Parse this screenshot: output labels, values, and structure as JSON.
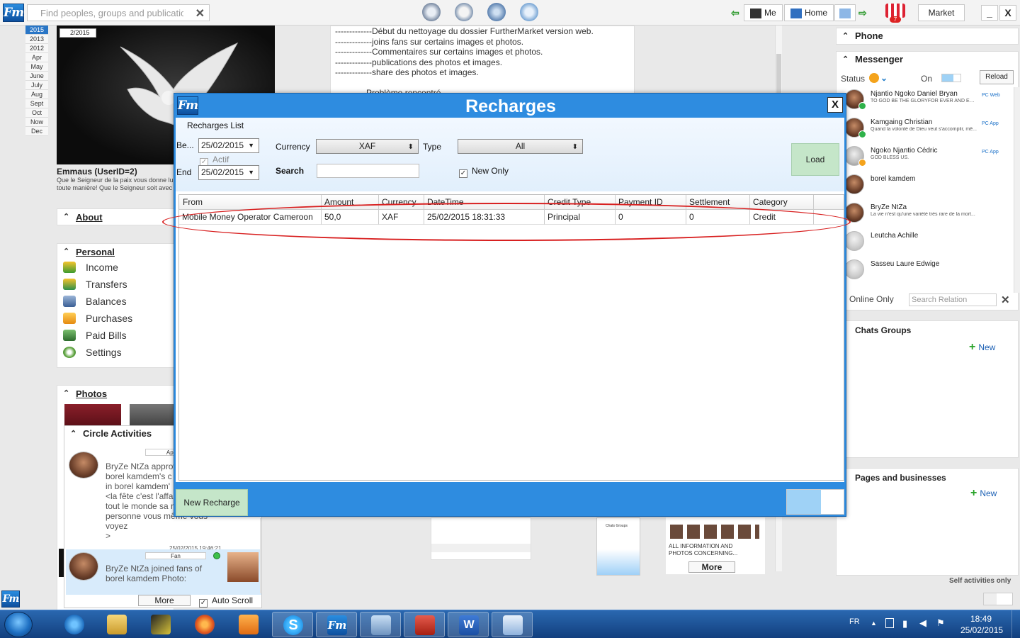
{
  "topbar": {
    "search_placeholder": "Find peoples, groups and publications",
    "me_label": "Me",
    "home_label": "Home",
    "market_label": "Market",
    "minimize": "_",
    "close": "X",
    "cart_badge": "7"
  },
  "years": [
    "2015",
    "2013",
    "2012",
    "Apr",
    "May",
    "June",
    "July",
    "Aug",
    "Sept",
    "Oct",
    "Now",
    "Dec"
  ],
  "hero": {
    "badge": "2/2015",
    "name": "Emmaus (UserID=2)",
    "desc": "Que le Seigneur de la paix vous donne lui toute manière! Que le Seigneur soit avec"
  },
  "about_label": "About",
  "personal": {
    "title": "Personal",
    "items": [
      "Income",
      "Transfers",
      "Balances",
      "Purchases",
      "Paid Bills",
      "Settings"
    ]
  },
  "photos_label": "Photos",
  "activities": {
    "title": "Circle Activities",
    "chip1": "App",
    "item1_lines": [
      "BryZe NtZa approv",
      "borel kamdem's c",
      "in  borel kamdem'",
      "<la fête c'est l'affa",
      "tout le monde sa n",
      "personne vous même vous",
      "voyez",
      ">"
    ],
    "stamp": "25/02/2015 19:46:21",
    "chip2": "Fan",
    "item2_lines": [
      "BryZe NtZa joined fans of",
      "borel kamdem Photo:"
    ],
    "more_label": "More",
    "autoscroll_label": "Auto Scroll"
  },
  "news_lines": [
    "-------------Début du nettoyage du dossier FurtherMarket version web.",
    "-------------joins fans sur certains images et photos.",
    "-------------Commentaires sur certains images et photos.",
    "-------------publications des photos et images.",
    "-------------share des photos et images.",
    "",
    "            Problème  rencontré"
  ],
  "mid_more": {
    "caption": "ALL INFORMATION AND PHOTOS CONCERNING...",
    "more_label": "More",
    "thumb_label": "Chats Groups"
  },
  "right": {
    "phone_title": "Phone",
    "messenger_title": "Messenger",
    "status_label": "Status",
    "on_label": "On",
    "reload_label": "Reload",
    "contacts": [
      {
        "name": "Njantio Ngoko Daniel Bryan",
        "status": "TO GOD BE THE GLORYFOR EVER AND EVER.",
        "platform": "PC Web"
      },
      {
        "name": "Kamgaing Christian",
        "status": "Quand la volonté de Dieu veut s'accomplir, mê...",
        "platform": "PC App"
      },
      {
        "name": "Ngoko Njantio Cédric",
        "status": "GOD BLESS US.",
        "platform": "PC App"
      },
      {
        "name": "borel kamdem",
        "status": "",
        "platform": ""
      },
      {
        "name": "BryZe NtZa",
        "status": "La vie n'est qu'une variété très rare de la mort...",
        "platform": ""
      },
      {
        "name": "Leutcha Achille",
        "status": "",
        "platform": ""
      },
      {
        "name": "Sasseu Laure Edwige",
        "status": "",
        "platform": ""
      }
    ],
    "online_only_label": "Online Only",
    "search_relation_placeholder": "Search Relation",
    "chats_groups_title": "Chats Groups",
    "new_label": "New",
    "pages_title": "Pages and businesses",
    "self_activities_label": "Self activities only"
  },
  "dialog": {
    "title": "Recharges",
    "close": "X",
    "list_label": "Recharges List",
    "begin_label": "Be...",
    "begin_value": "25/02/2015",
    "actif_label": "Actif",
    "end_label": "End",
    "end_value": "25/02/2015",
    "currency_label": "Currency",
    "currency_value": "XAF",
    "type_label": "Type",
    "type_value": "All",
    "search_label": "Search",
    "search_value": "",
    "new_only_label": "New Only",
    "load_label": "Load",
    "columns": [
      "From",
      "Amount",
      "Currency",
      "DateTime",
      "Credit Type",
      "Payment ID",
      "Settlement",
      "Category"
    ],
    "rows": [
      [
        "Mobile Money Operator Cameroon",
        "50,0",
        "XAF",
        "25/02/2015 18:31:33",
        "Principal",
        "0",
        "0",
        "Credit"
      ]
    ],
    "new_recharge_label": "New Recharge"
  },
  "taskbar": {
    "lang": "FR",
    "time": "18:49",
    "date": "25/02/2015"
  }
}
